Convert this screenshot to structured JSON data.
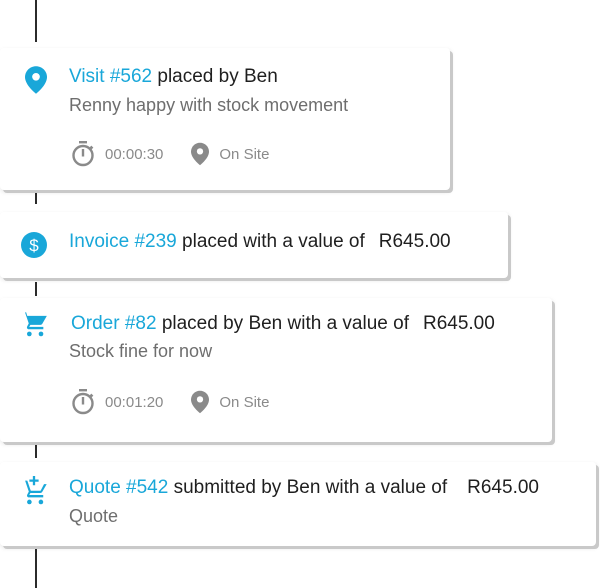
{
  "colors": {
    "accent": "#19a7d9",
    "line": "#2b2b2b",
    "muted": "#8a8a8a"
  },
  "timeline": [
    {
      "icon": "location-pin-icon",
      "link": "Visit #562",
      "text": " placed by Ben",
      "amount": "",
      "subtitle": "Renny happy with stock movement",
      "duration": "00:00:30",
      "status": "On Site"
    },
    {
      "icon": "dollar-circle-icon",
      "link": "Invoice #239",
      "text": " placed with a value of",
      "amount": "R645.00"
    },
    {
      "icon": "shopping-cart-icon",
      "link": "Order #82",
      "text": " placed by Ben with a value of",
      "amount": "R645.00",
      "subtitle": "Stock fine for now",
      "duration": "00:01:20",
      "status": "On Site"
    },
    {
      "icon": "add-to-cart-icon",
      "link": "Quote #542",
      "text": " submitted by Ben with a value of",
      "amount": "R645.00",
      "subtitle": "Quote"
    }
  ]
}
